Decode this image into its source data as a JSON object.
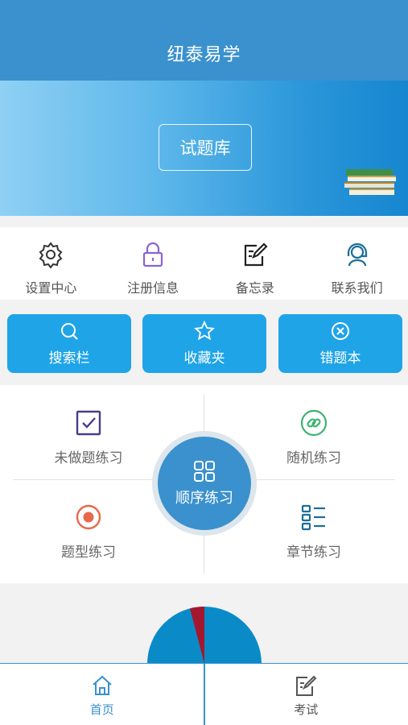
{
  "header": {
    "title": "纽泰易学"
  },
  "banner": {
    "button_label": "试题库"
  },
  "quick_actions": [
    {
      "label": "设置中心",
      "icon": "gear-icon"
    },
    {
      "label": "注册信息",
      "icon": "lock-icon"
    },
    {
      "label": "备忘录",
      "icon": "note-edit-icon"
    },
    {
      "label": "联系我们",
      "icon": "support-agent-icon"
    }
  ],
  "pills": [
    {
      "label": "搜索栏",
      "icon": "search-icon"
    },
    {
      "label": "收藏夹",
      "icon": "star-icon"
    },
    {
      "label": "错题本",
      "icon": "close-circle-icon"
    }
  ],
  "practice": {
    "unfinished": {
      "label": "未做题练习",
      "icon": "checkbox-icon"
    },
    "random": {
      "label": "随机练习",
      "icon": "link-icon"
    },
    "type": {
      "label": "题型练习",
      "icon": "target-icon"
    },
    "chapter": {
      "label": "章节练习",
      "icon": "list-icon"
    },
    "sequential": {
      "label": "顺序练习",
      "icon": "grid-icon"
    }
  },
  "tabs": [
    {
      "label": "首页",
      "icon": "home-icon",
      "active": true
    },
    {
      "label": "考试",
      "icon": "exam-edit-icon",
      "active": false
    }
  ],
  "colors": {
    "primary": "#3a91cd",
    "pill": "#1fa4e8",
    "purple": "#8a63d2",
    "green": "#3cb371",
    "orange": "#e8684a",
    "pie_blue": "#0a8bc8",
    "pie_red": "#a3182e"
  }
}
